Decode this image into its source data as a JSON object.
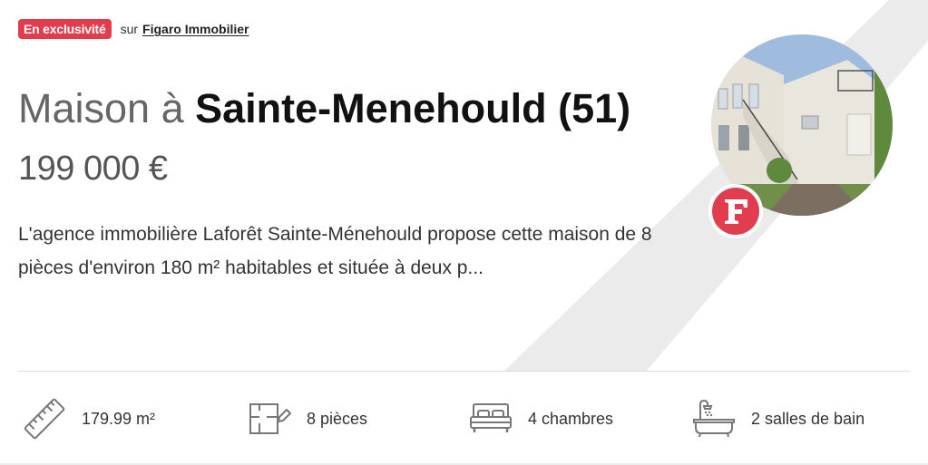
{
  "badge": "En exclusivité",
  "source": {
    "prefix": "sur",
    "name": "Figaro Immobilier"
  },
  "title": {
    "prefix": "Maison à ",
    "city": "Sainte-Menehould (51)"
  },
  "price": "199 000 €",
  "description": "L'agence immobilière Laforêt Sainte-Ménehould propose cette maison de 8 pièces d'environ 180 m² habitables et située à deux p...",
  "logo": {
    "letter": "F",
    "color": "#e13d4e"
  },
  "features": [
    {
      "icon": "ruler-icon",
      "label": "179.99 m²"
    },
    {
      "icon": "floorplan-icon",
      "label": "8 pièces"
    },
    {
      "icon": "bed-icon",
      "label": "4 chambres"
    },
    {
      "icon": "bathtub-icon",
      "label": "2 salles de bain"
    }
  ],
  "colors": {
    "accent": "#e13d4e",
    "stripe": "#ebebeb"
  }
}
